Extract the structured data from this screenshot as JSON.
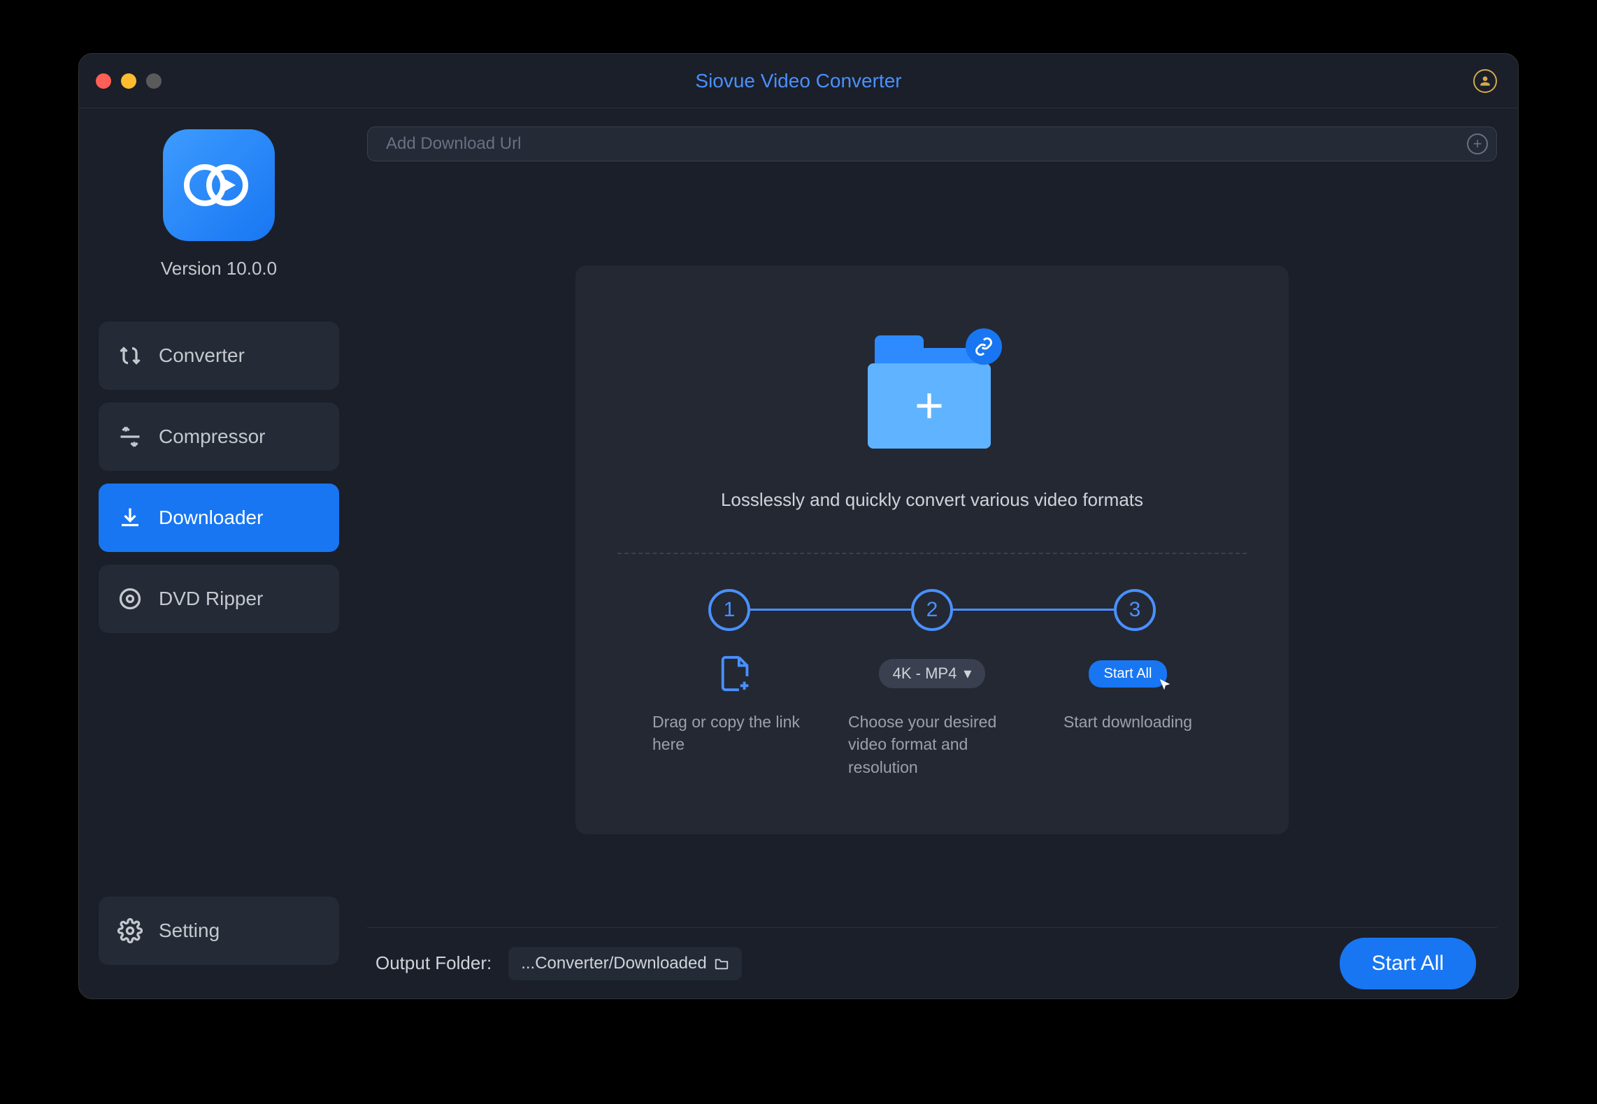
{
  "title": "Siovue Video Converter",
  "version": "Version 10.0.0",
  "sidebar": {
    "items": [
      {
        "label": "Converter"
      },
      {
        "label": "Compressor"
      },
      {
        "label": "Downloader"
      },
      {
        "label": "DVD Ripper"
      }
    ],
    "setting_label": "Setting"
  },
  "url_placeholder": "Add Download Url",
  "tagline": "Losslessly and quickly convert various video formats",
  "steps": {
    "numbers": [
      "1",
      "2",
      "3"
    ],
    "format_label": "4K - MP4",
    "mini_start": "Start All",
    "desc1": "Drag or copy the link here",
    "desc2": "Choose your desired video format and resolution",
    "desc3": "Start downloading"
  },
  "footer": {
    "output_label": "Output Folder:",
    "output_path": "...Converter/Downloaded",
    "start_label": "Start All"
  }
}
